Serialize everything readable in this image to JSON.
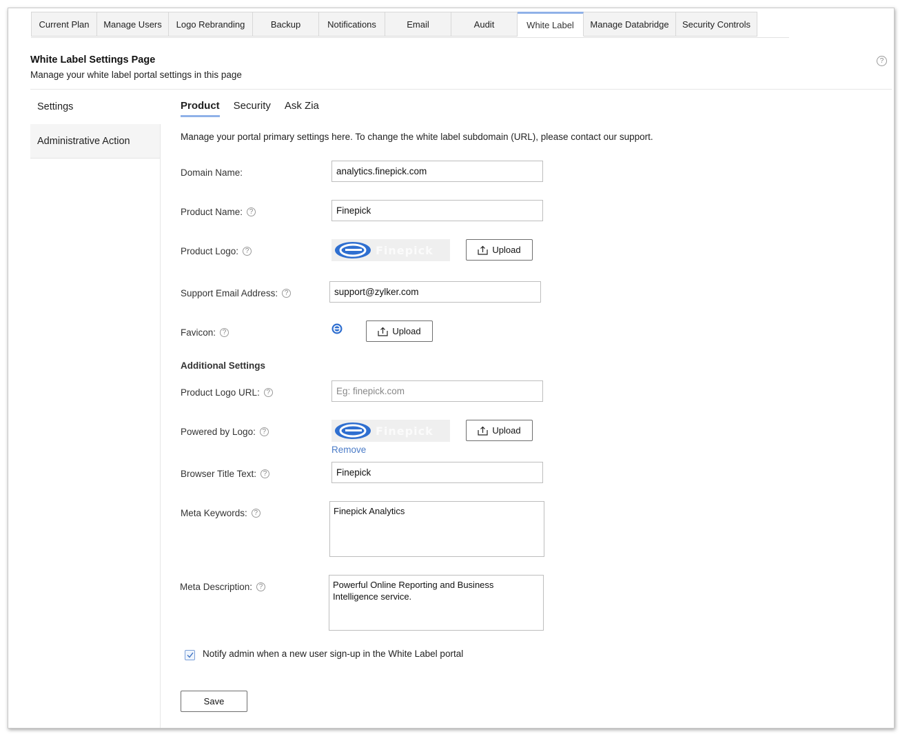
{
  "tabs": [
    {
      "label": "Current Plan"
    },
    {
      "label": "Manage Users"
    },
    {
      "label": "Logo Rebranding"
    },
    {
      "label": "Backup"
    },
    {
      "label": "Notifications"
    },
    {
      "label": "Email"
    },
    {
      "label": "Audit"
    },
    {
      "label": "White Label",
      "active": true
    },
    {
      "label": "Manage Databridge"
    },
    {
      "label": "Security Controls"
    }
  ],
  "header": {
    "title": "White Label Settings Page",
    "subtitle": "Manage your white label portal settings in this page"
  },
  "sidebar": {
    "items": [
      {
        "label": "Settings"
      },
      {
        "label": "Administrative Action"
      }
    ]
  },
  "subtabs": [
    {
      "label": "Product",
      "active": true
    },
    {
      "label": "Security"
    },
    {
      "label": "Ask Zia"
    }
  ],
  "intro": "Manage your portal primary settings here. To change the white label subdomain (URL), please contact our support.",
  "form": {
    "domain_name": {
      "label": "Domain Name:",
      "value": "analytics.finepick.com"
    },
    "product_name": {
      "label": "Product Name:",
      "value": "Finepick"
    },
    "product_logo": {
      "label": "Product Logo:",
      "logo_text": "Finepick",
      "upload_label": "Upload"
    },
    "support_email": {
      "label": "Support Email Address:",
      "value": "support@zylker.com"
    },
    "favicon": {
      "label": "Favicon:",
      "upload_label": "Upload"
    },
    "additional_title": "Additional Settings",
    "product_logo_url": {
      "label": "Product Logo URL:",
      "placeholder": "Eg: finepick.com",
      "value": ""
    },
    "powered_by_logo": {
      "label": "Powered by Logo:",
      "logo_text": "Finepick",
      "upload_label": "Upload",
      "remove_label": "Remove"
    },
    "browser_title": {
      "label": "Browser Title Text:",
      "value": "Finepick"
    },
    "meta_keywords": {
      "label": "Meta Keywords:",
      "value": "Finepick Analytics"
    },
    "meta_description": {
      "label": "Meta Description:",
      "value": "Powerful Online Reporting and Business Intelligence service."
    },
    "notify": {
      "label": "Notify admin when a new user sign-up in the White Label portal",
      "checked": true
    },
    "save_label": "Save"
  },
  "help_glyph": "?",
  "colors": {
    "accent": "#8fb1e8",
    "link": "#4a7bc7",
    "logo_blue": "#2f6fd0"
  }
}
